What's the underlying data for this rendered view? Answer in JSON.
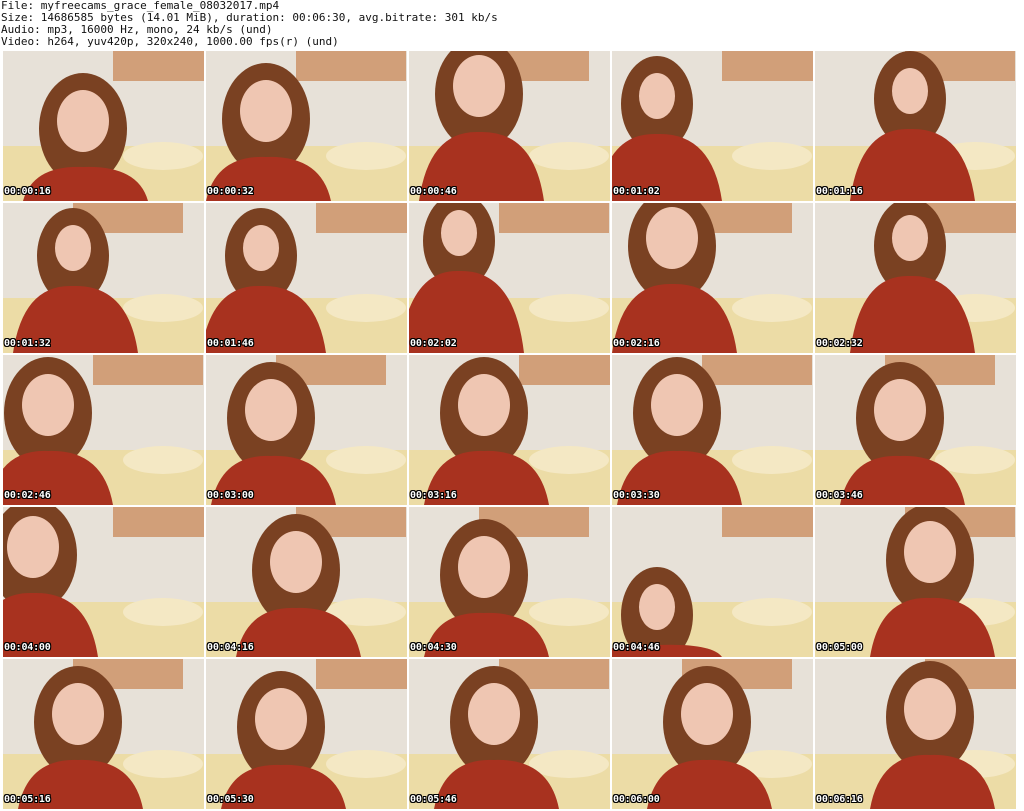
{
  "header": {
    "file_line": "File: myfreecams_grace_female_08032017.mp4",
    "size_line": "Size: 14686585 bytes (14.01 MiB), duration: 00:06:30, avg.bitrate: 301 kb/s",
    "audio_line": "Audio: mp3, 16000 Hz, mono, 24 kb/s (und)",
    "video_line": "Video: h264, yuv420p, 320x240, 1000.00 fps(r) (und)"
  },
  "frames": [
    {
      "timestamp": "00:00:16"
    },
    {
      "timestamp": "00:00:32"
    },
    {
      "timestamp": "00:00:46"
    },
    {
      "timestamp": "00:01:02"
    },
    {
      "timestamp": "00:01:16"
    },
    {
      "timestamp": "00:01:32"
    },
    {
      "timestamp": "00:01:46"
    },
    {
      "timestamp": "00:02:02"
    },
    {
      "timestamp": "00:02:16"
    },
    {
      "timestamp": "00:02:32"
    },
    {
      "timestamp": "00:02:46"
    },
    {
      "timestamp": "00:03:00"
    },
    {
      "timestamp": "00:03:16"
    },
    {
      "timestamp": "00:03:30"
    },
    {
      "timestamp": "00:03:46"
    },
    {
      "timestamp": "00:04:00"
    },
    {
      "timestamp": "00:04:16"
    },
    {
      "timestamp": "00:04:30"
    },
    {
      "timestamp": "00:04:46"
    },
    {
      "timestamp": "00:05:00"
    },
    {
      "timestamp": "00:05:16"
    },
    {
      "timestamp": "00:05:30"
    },
    {
      "timestamp": "00:05:46"
    },
    {
      "timestamp": "00:06:00"
    },
    {
      "timestamp": "00:06:16"
    }
  ],
  "colors": {
    "wall": "#e7e1d8",
    "bedding": "#ecdca6",
    "dress": "#a8321f",
    "hair": "#7a4122",
    "skin": "#efc6b2",
    "painting": "#c9885a"
  }
}
